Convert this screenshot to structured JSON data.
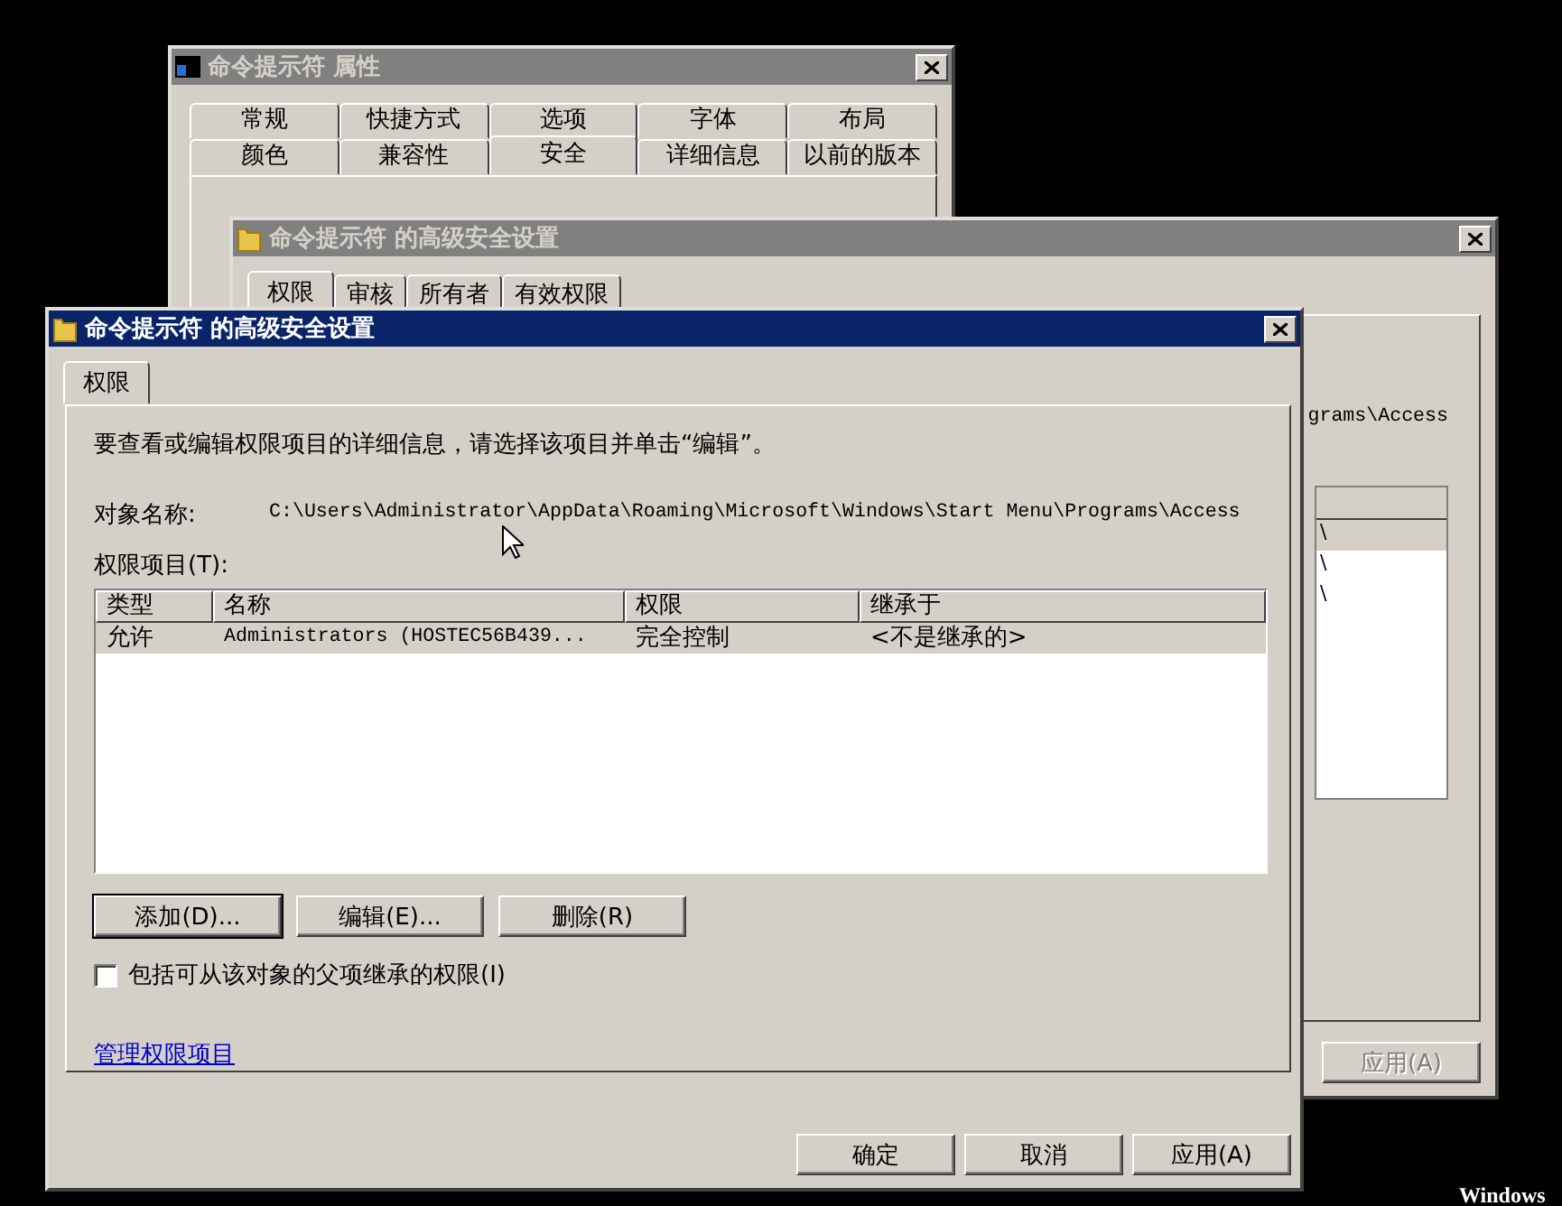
{
  "properties_window": {
    "title": "命令提示符 属性",
    "active": false,
    "tab_rows": [
      [
        {
          "label": "常规",
          "selected": false
        },
        {
          "label": "快捷方式",
          "selected": false
        },
        {
          "label": "选项",
          "selected": false
        },
        {
          "label": "字体",
          "selected": false
        },
        {
          "label": "布局",
          "selected": false
        }
      ],
      [
        {
          "label": "颜色",
          "selected": false
        },
        {
          "label": "兼容性",
          "selected": false
        },
        {
          "label": "安全",
          "selected": true
        },
        {
          "label": "详细信息",
          "selected": false
        },
        {
          "label": "以前的版本",
          "selected": false
        }
      ]
    ]
  },
  "advanced_window_back": {
    "title": "命令提示符 的高级安全设置",
    "active": false,
    "tabs": [
      {
        "label": "权限",
        "selected": true
      },
      {
        "label": "审核",
        "selected": false
      },
      {
        "label": "所有者",
        "selected": false
      },
      {
        "label": "有效权限",
        "selected": false
      }
    ],
    "path_fragment": "grams\\Access",
    "rows": [
      {
        "text": "\\",
        "selected": true
      },
      {
        "text": "\\",
        "selected": false
      },
      {
        "text": "\\",
        "selected": false
      }
    ],
    "apply_button": {
      "label": "应用(A)",
      "disabled": true
    }
  },
  "advanced_window_front": {
    "title": "命令提示符 的高级安全设置",
    "active": true,
    "tabs": [
      {
        "label": "权限",
        "selected": true
      }
    ],
    "description": "要查看或编辑权限项目的详细信息，请选择该项目并单击“编辑”。",
    "object_name_label": "对象名称:",
    "object_name": "C:\\Users\\Administrator\\AppData\\Roaming\\Microsoft\\Windows\\Start Menu\\Programs\\Access",
    "entries_label": "权限项目(T):",
    "columns": [
      "类型",
      "名称",
      "权限",
      "继承于"
    ],
    "rows": [
      {
        "cells": [
          "允许",
          "Administrators (HOSTEC56B439...",
          "完全控制",
          "<不是继承的>"
        ],
        "selected": true
      }
    ],
    "buttons": [
      {
        "label": "添加(D)...",
        "default": true
      },
      {
        "label": "编辑(E)...",
        "default": false
      },
      {
        "label": "删除(R)",
        "default": false
      }
    ],
    "checkbox": {
      "label": "包括可从该对象的父项继承的权限(I)",
      "checked": false
    },
    "link": "管理权限项目",
    "footer_buttons": [
      "确定",
      "取消",
      "应用(A)"
    ]
  },
  "desktop_text": "Windows"
}
